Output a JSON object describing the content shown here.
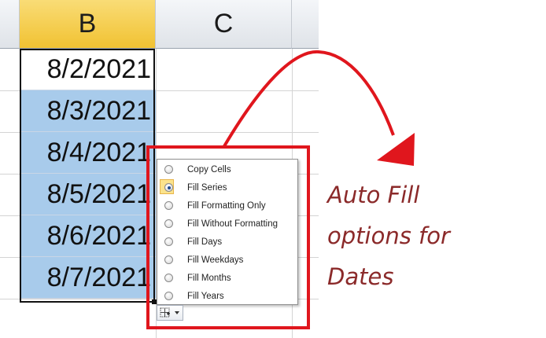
{
  "columns": {
    "a": "",
    "b": "B",
    "c": "C"
  },
  "cells": [
    "8/2/2021",
    "8/3/2021",
    "8/4/2021",
    "8/5/2021",
    "8/6/2021",
    "8/7/2021"
  ],
  "autofill_menu": {
    "items": [
      {
        "label": "Copy Cells",
        "selected": false
      },
      {
        "label": "Fill Series",
        "selected": true
      },
      {
        "label": "Fill Formatting Only",
        "selected": false
      },
      {
        "label": "Fill Without Formatting",
        "selected": false
      },
      {
        "label": "Fill Days",
        "selected": false
      },
      {
        "label": "Fill Weekdays",
        "selected": false
      },
      {
        "label": "Fill Months",
        "selected": false
      },
      {
        "label": "Fill Years",
        "selected": false
      }
    ],
    "button_icon": "auto-fill-options-icon"
  },
  "annotation": {
    "lines": [
      "Auto Fill",
      "options for",
      "Dates"
    ]
  },
  "colors": {
    "selection": "#a8cbeb",
    "active_header": "#f1c232",
    "highlight": "#e0161d",
    "caption": "#8b2a2a"
  }
}
